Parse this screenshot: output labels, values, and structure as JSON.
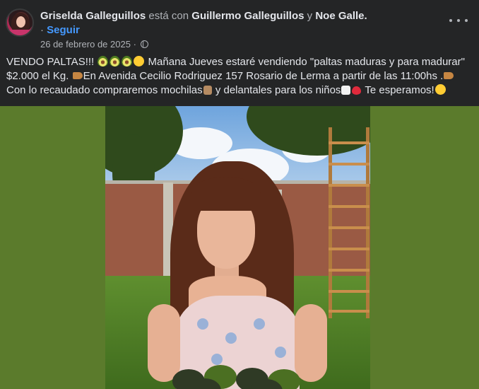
{
  "post": {
    "author": "Griselda Galleguillos",
    "with_text": "está con",
    "tagged_1": "Guillermo Galleguillos",
    "and_text": "y",
    "tagged_2": "Noe Galle.",
    "follow_dot": "·",
    "follow_label": "Seguir",
    "date": "26 de febrero de 2025",
    "date_sep": "·",
    "privacy_icon": "globe-icon",
    "more_icon": "more-options-icon",
    "text": {
      "p1": "VENDO PALTAS!!!",
      "p2": "Mañana Jueves estaré vendiendo \"paltas maduras y para madurar\" $2.000 el Kg.",
      "p3": "En Avenida Cecilio Rodriguez 157 Rosario de Lerma a partir de las 11:00hs .",
      "p4": "Con lo recaudado compraremos mochilas",
      "p5": "y  delantales  para los niños",
      "p6": "Te esperamos!"
    },
    "photo_bg_color": "#5b7b2c"
  }
}
